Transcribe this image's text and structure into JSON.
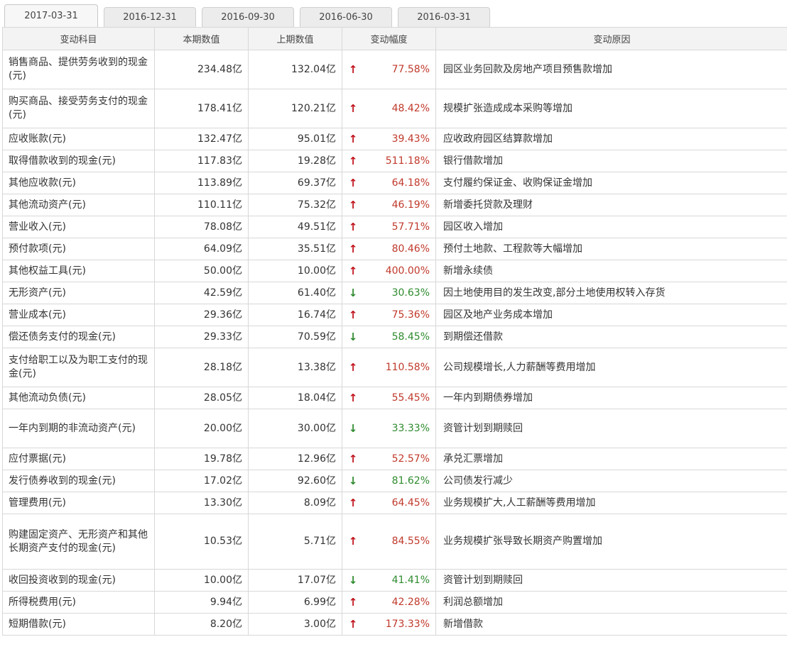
{
  "tabs": [
    "2017-03-31",
    "2016-12-31",
    "2016-09-30",
    "2016-06-30",
    "2016-03-31"
  ],
  "colors": {
    "up": "#c0141c",
    "down": "#2e8b2e"
  },
  "table": {
    "headers": [
      "变动科目",
      "本期数值",
      "上期数值",
      "变动幅度",
      "变动原因"
    ],
    "rows": [
      {
        "name": "销售商品、提供劳务收到的现金(元)",
        "current": "234.48亿",
        "previous": "132.04亿",
        "direction": "up",
        "pct": "77.58%",
        "reason": "园区业务回款及房地产项目预售款增加",
        "lines": 2
      },
      {
        "name": "购买商品、接受劳务支付的现金(元)",
        "current": "178.41亿",
        "previous": "120.21亿",
        "direction": "up",
        "pct": "48.42%",
        "reason": "规模扩张造成成本采购等增加",
        "lines": 2
      },
      {
        "name": "应收账款(元)",
        "current": "132.47亿",
        "previous": "95.01亿",
        "direction": "up",
        "pct": "39.43%",
        "reason": "应收政府园区结算款增加",
        "lines": 1
      },
      {
        "name": "取得借款收到的现金(元)",
        "current": "117.83亿",
        "previous": "19.28亿",
        "direction": "up",
        "pct": "511.18%",
        "reason": "银行借款增加",
        "lines": 1
      },
      {
        "name": "其他应收款(元)",
        "current": "113.89亿",
        "previous": "69.37亿",
        "direction": "up",
        "pct": "64.18%",
        "reason": "支付履约保证金、收购保证金增加",
        "lines": 1
      },
      {
        "name": "其他流动资产(元)",
        "current": "110.11亿",
        "previous": "75.32亿",
        "direction": "up",
        "pct": "46.19%",
        "reason": "新增委托贷款及理财",
        "lines": 1
      },
      {
        "name": "营业收入(元)",
        "current": "78.08亿",
        "previous": "49.51亿",
        "direction": "up",
        "pct": "57.71%",
        "reason": "园区收入增加",
        "lines": 1
      },
      {
        "name": "预付款项(元)",
        "current": "64.09亿",
        "previous": "35.51亿",
        "direction": "up",
        "pct": "80.46%",
        "reason": "预付土地款、工程款等大幅增加",
        "lines": 1
      },
      {
        "name": "其他权益工具(元)",
        "current": "50.00亿",
        "previous": "10.00亿",
        "direction": "up",
        "pct": "400.00%",
        "reason": "新增永续债",
        "lines": 1
      },
      {
        "name": "无形资产(元)",
        "current": "42.59亿",
        "previous": "61.40亿",
        "direction": "down",
        "pct": "30.63%",
        "reason": "因土地使用目的发生改变,部分土地使用权转入存货",
        "lines": 1
      },
      {
        "name": "营业成本(元)",
        "current": "29.36亿",
        "previous": "16.74亿",
        "direction": "up",
        "pct": "75.36%",
        "reason": "园区及地产业务成本增加",
        "lines": 1
      },
      {
        "name": "偿还债务支付的现金(元)",
        "current": "29.33亿",
        "previous": "70.59亿",
        "direction": "down",
        "pct": "58.45%",
        "reason": "到期偿还借款",
        "lines": 1
      },
      {
        "name": "支付给职工以及为职工支付的现金(元)",
        "current": "28.18亿",
        "previous": "13.38亿",
        "direction": "up",
        "pct": "110.58%",
        "reason": "公司规模增长,人力薪酬等费用增加",
        "lines": 2
      },
      {
        "name": "其他流动负债(元)",
        "current": "28.05亿",
        "previous": "18.04亿",
        "direction": "up",
        "pct": "55.45%",
        "reason": "一年内到期债券增加",
        "lines": 1
      },
      {
        "name": "一年内到期的非流动资产(元)",
        "current": "20.00亿",
        "previous": "30.00亿",
        "direction": "down",
        "pct": "33.33%",
        "reason": "资管计划到期赎回",
        "lines": 2
      },
      {
        "name": "应付票据(元)",
        "current": "19.78亿",
        "previous": "12.96亿",
        "direction": "up",
        "pct": "52.57%",
        "reason": "承兑汇票增加",
        "lines": 1
      },
      {
        "name": "发行债券收到的现金(元)",
        "current": "17.02亿",
        "previous": "92.60亿",
        "direction": "down",
        "pct": "81.62%",
        "reason": "公司债发行减少",
        "lines": 1
      },
      {
        "name": "管理费用(元)",
        "current": "13.30亿",
        "previous": "8.09亿",
        "direction": "up",
        "pct": "64.45%",
        "reason": "业务规模扩大,人工薪酬等费用增加",
        "lines": 1
      },
      {
        "name": "购建固定资产、无形资产和其他长期资产支付的现金(元)",
        "current": "10.53亿",
        "previous": "5.71亿",
        "direction": "up",
        "pct": "84.55%",
        "reason": "业务规模扩张导致长期资产购置增加",
        "lines": 3
      },
      {
        "name": "收回投资收到的现金(元)",
        "current": "10.00亿",
        "previous": "17.07亿",
        "direction": "down",
        "pct": "41.41%",
        "reason": "资管计划到期赎回",
        "lines": 1
      },
      {
        "name": "所得税费用(元)",
        "current": "9.94亿",
        "previous": "6.99亿",
        "direction": "up",
        "pct": "42.28%",
        "reason": "利润总额增加",
        "lines": 1
      },
      {
        "name": "短期借款(元)",
        "current": "8.20亿",
        "previous": "3.00亿",
        "direction": "up",
        "pct": "173.33%",
        "reason": "新增借款",
        "lines": 1
      }
    ]
  }
}
